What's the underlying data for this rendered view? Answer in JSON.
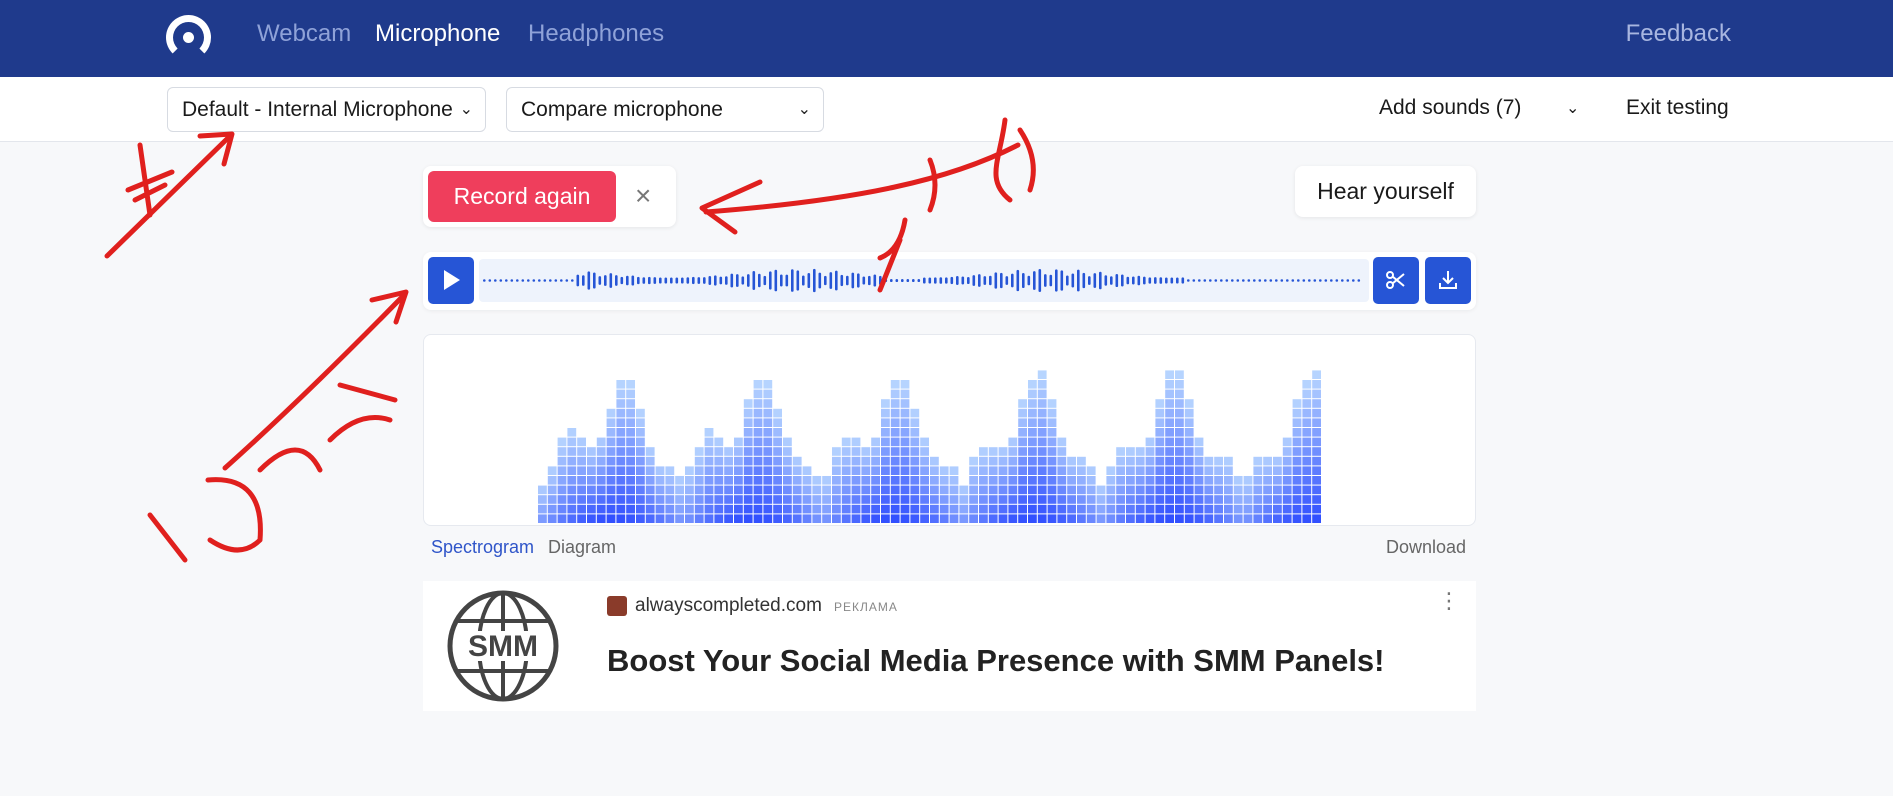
{
  "nav": {
    "links": [
      "Webcam",
      "Microphone",
      "Headphones"
    ],
    "active": "Microphone",
    "feedback": "Feedback"
  },
  "toolbar": {
    "device_select": "Default - Internal Microphone",
    "compare_select": "Compare microphone",
    "add_sounds": "Add sounds (7)",
    "exit_testing": "Exit testing"
  },
  "recorder": {
    "record_again": "Record again",
    "close": "×",
    "hear_yourself": "Hear yourself"
  },
  "spectrogram": {
    "tab_spectrogram": "Spectrogram",
    "tab_diagram": "Diagram",
    "download": "Download"
  },
  "ad": {
    "site": "alwayscompleted.com",
    "tag": "РЕКЛАМА",
    "title": "Boost Your Social Media Presence with SMM Panels!",
    "image_text": "SMM"
  },
  "colors": {
    "nav_bg": "#1f3a8c",
    "accent_blue": "#2655d6",
    "record_red": "#ef3e5c",
    "annotation_red": "#e0201e"
  }
}
